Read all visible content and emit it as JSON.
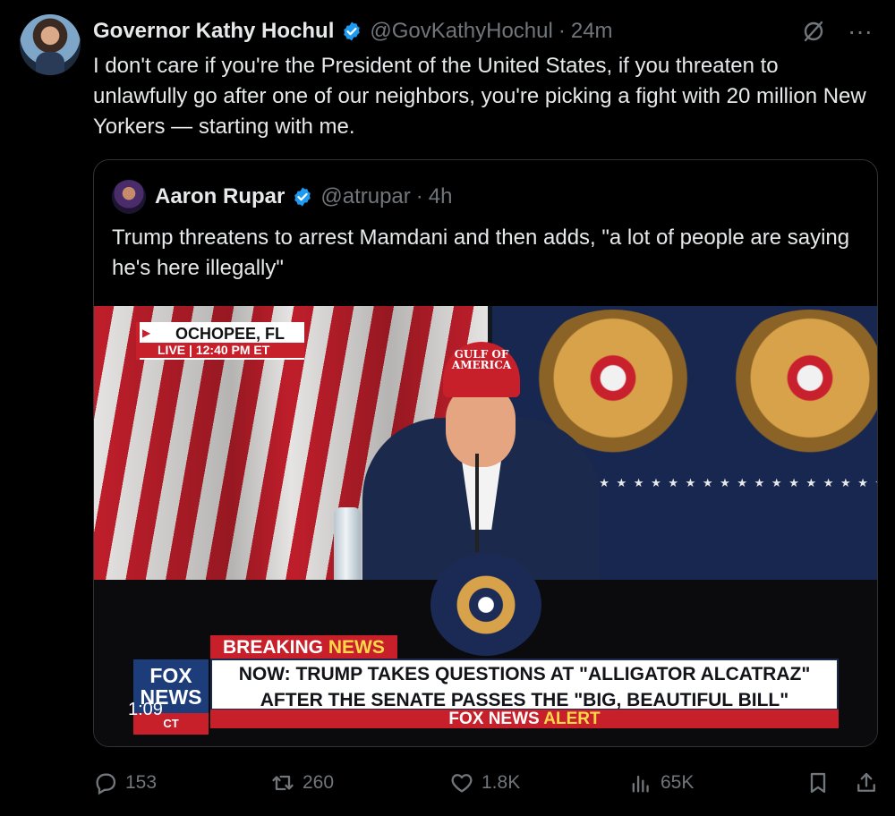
{
  "post": {
    "author_name": "Governor Kathy Hochul",
    "handle": "@GovKathyHochul",
    "separator": "·",
    "time": "24m",
    "text": "I don't care if you're the President of the United States, if you threaten to unlawfully go after one of our neighbors, you're picking a fight with 20 million New Yorkers — starting with me.",
    "more_icon_glyph": "···"
  },
  "quote": {
    "author_name": "Aaron Rupar",
    "handle": "@atrupar",
    "separator": "·",
    "time": "4h",
    "text": "Trump threatens to arrest Mamdani and then adds, \"a lot of people are saying he's here illegally\"",
    "video": {
      "location": "OCHOPEE, FL",
      "live_label": "LIVE",
      "live_time": "12:40 PM ET",
      "cap_text": "GULF OF AMERICA",
      "breaking_label_white": "BREAKING",
      "breaking_label_yellow": "NEWS",
      "headline_line1": "NOW: TRUMP TAKES QUESTIONS AT \"ALLIGATOR ALCATRAZ\"",
      "headline_line2": "AFTER THE SENATE PASSES THE \"BIG, BEAUTIFUL BILL\"",
      "alert_white": "FOX NEWS",
      "alert_yellow": "ALERT",
      "network_logo_line1": "FOX",
      "network_logo_line2": "NEWS",
      "network_logo_sub": "CT",
      "duration": "1:09",
      "stars": "★ ★ ★ ★ ★ ★ ★ ★ ★ ★ ★ ★ ★ ★ ★ ★ ★ ★ ★ ★ ★ ★ ★ ★"
    }
  },
  "actions": {
    "replies": "153",
    "reposts": "260",
    "likes": "1.8K",
    "views": "65K"
  },
  "colors": {
    "background": "#000000",
    "text": "#e7e9ea",
    "muted": "#71767b",
    "verified": "#1d9bf0",
    "fox_red": "#c8202b"
  }
}
